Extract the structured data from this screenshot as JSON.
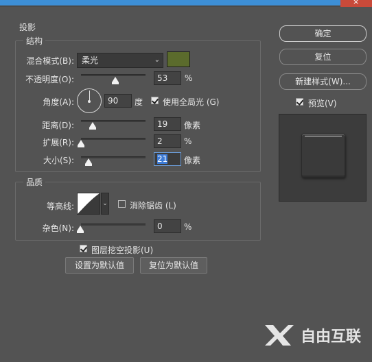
{
  "window": {
    "close_glyph": "×"
  },
  "shadow": {
    "section_title": "投影",
    "structure": {
      "title": "结构",
      "blend_mode_label": "混合模式(B):",
      "blend_mode_value": "柔光",
      "color_swatch": "#5b6b2c",
      "opacity_label": "不透明度(O):",
      "opacity_value": "53",
      "opacity_unit": "%",
      "opacity_level": 0.53,
      "angle_label": "角度(A):",
      "angle_value": "90",
      "angle_unit": "度",
      "global_light_label": "使用全局光 (G)",
      "global_light_checked": true,
      "distance_label": "距离(D):",
      "distance_value": "19",
      "distance_unit": "像素",
      "spread_label": "扩展(R):",
      "spread_value": "2",
      "spread_unit": "%",
      "size_label": "大小(S):",
      "size_value": "21",
      "size_unit": "像素"
    },
    "quality": {
      "title": "品质",
      "contour_label": "等高线:",
      "anti_alias_label": "消除锯齿 (L)",
      "anti_alias_checked": false,
      "noise_label": "杂色(N):",
      "noise_value": "0",
      "noise_unit": "%"
    },
    "knockout_label": "图层挖空投影(U)",
    "knockout_checked": true,
    "set_default_label": "设置为默认值",
    "reset_default_label": "复位为默认值"
  },
  "right_panel": {
    "ok_label": "确定",
    "reset_label": "复位",
    "new_style_label": "新建样式(W)...",
    "preview_label": "预览(V)",
    "preview_checked": true
  },
  "watermark": {
    "text": "自由互联"
  },
  "colors": {
    "panel_bg": "#535353",
    "accent_blue": "#3d8fd6",
    "close_red": "#c94a3a"
  }
}
